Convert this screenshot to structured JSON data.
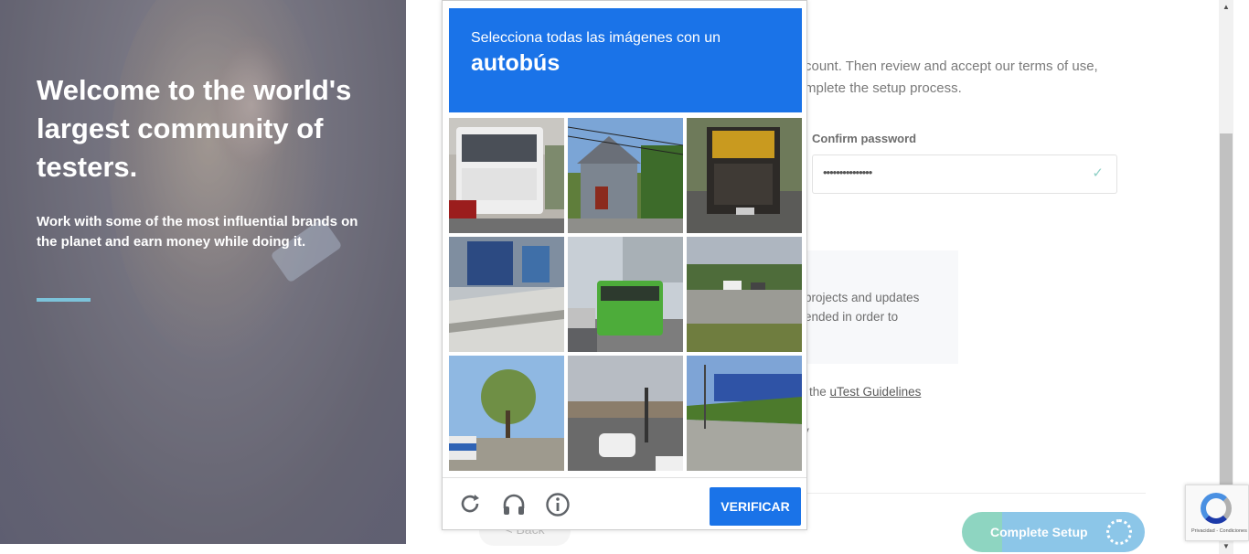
{
  "hero": {
    "title": "Welcome to the world's largest community of testers.",
    "subtitle": "Work with some of the most influential brands on the planet and earn money while doing it."
  },
  "form": {
    "intro_line1": "count. Then review and accept our terms of use,",
    "intro_line2": "mplete the setup process.",
    "confirm_password_label": "Confirm password",
    "confirm_password_value": "•••••••••••••••",
    "info_line1": "projects and updates",
    "info_line2": "ended in order to",
    "guidelines_prefix": "the ",
    "guidelines_link": "uTest Guidelines",
    "fragment_y": "y",
    "back_label": "< Back",
    "complete_label": "Complete Setup"
  },
  "captcha": {
    "instruction": "Selecciona todas las imágenes con un",
    "target": "autobús",
    "tiles": [
      "white-bus-rear",
      "house-street",
      "truck-rear",
      "storefront-sidewalk",
      "green-bus-street",
      "parking-lot",
      "tree-bus-stop",
      "intersection-traffic",
      "fence-road"
    ],
    "reload_icon": "reload-icon",
    "audio_icon": "headphones-icon",
    "info_icon": "info-icon",
    "verify_label": "VERIFICAR"
  },
  "recaptcha_badge": {
    "text": "Privacidad - Condiciones"
  },
  "colors": {
    "captcha_blue": "#1a73e8",
    "accent_bar": "#7cc3da",
    "complete_green": "#8ed5c1",
    "complete_blue": "#8cc6e8"
  }
}
